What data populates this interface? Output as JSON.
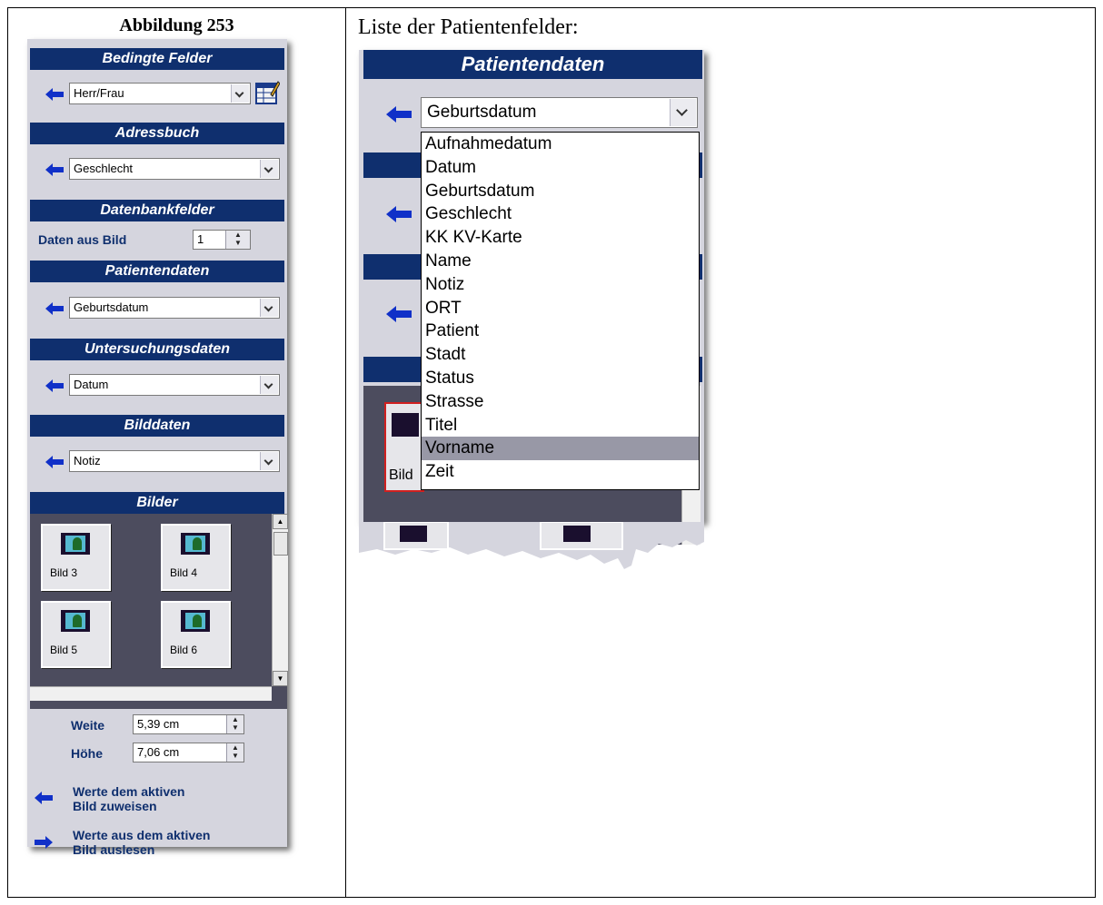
{
  "figure": {
    "caption": "Abbildung 253",
    "right_caption": "Liste der Patientenfelder:"
  },
  "panel": {
    "bedingte_felder": {
      "header": "Bedingte Felder",
      "value": "Herr/Frau"
    },
    "adressbuch": {
      "header": "Adressbuch",
      "value": "Geschlecht"
    },
    "datenbankfelder": {
      "header": "Datenbankfelder",
      "label": "Daten aus Bild",
      "value": "1"
    },
    "patientendaten": {
      "header": "Patientendaten",
      "value": "Geburtsdatum"
    },
    "untersuchungsdaten": {
      "header": "Untersuchungsdaten",
      "value": "Datum"
    },
    "bilddaten": {
      "header": "Bilddaten",
      "value": "Notiz"
    },
    "bilder": {
      "header": "Bilder",
      "thumbnails": [
        "Bild 3",
        "Bild 4",
        "Bild 5",
        "Bild 6"
      ]
    },
    "weite": {
      "label": "Weite",
      "value": "5,39 cm"
    },
    "hoehe": {
      "label": "Höhe",
      "value": "7,06 cm"
    },
    "assign": {
      "line1": "Werte dem aktiven",
      "line2": "Bild zuweisen"
    },
    "read": {
      "line1": "Werte aus dem aktiven",
      "line2": "Bild auslesen"
    }
  },
  "zoom": {
    "header": "Patientendaten",
    "value": "Geburtsdatum",
    "options": [
      "Aufnahmedatum",
      "Datum",
      "Geburtsdatum",
      "Geschlecht",
      "KK KV-Karte",
      "Name",
      "Notiz",
      "ORT",
      "Patient",
      "Stadt",
      "Status",
      "Strasse",
      "Titel",
      "Vorname",
      "Zeit"
    ],
    "selected_option": "Vorname",
    "partial_thumb_label": "Bild"
  },
  "colors": {
    "header_blue": "#0f2f6e",
    "panel_gray": "#d5d5de",
    "images_bg": "#4c4c5e",
    "arrow_blue": "#1030c8"
  },
  "icons": {
    "assign": "arrow-left-icon",
    "read": "arrow-right-icon",
    "editor": "table-edit-icon"
  }
}
